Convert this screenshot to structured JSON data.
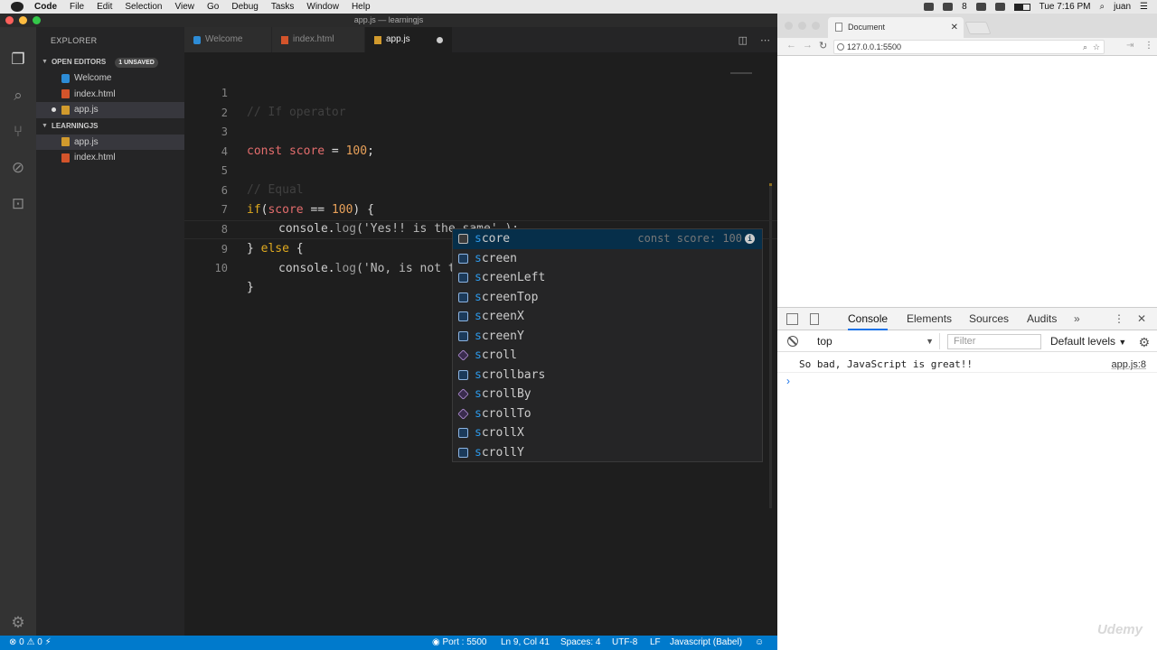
{
  "menubar": {
    "app": "Code",
    "items": [
      "File",
      "Edit",
      "Selection",
      "View",
      "Go",
      "Debug",
      "Tasks",
      "Window",
      "Help"
    ],
    "clock": "Tue 7:16 PM",
    "user": "juan",
    "tray_number": "8"
  },
  "vscode": {
    "window_title": "app.js — learningjs",
    "explorer_title": "EXPLORER",
    "open_editors": {
      "title": "OPEN EDITORS",
      "badge": "1 UNSAVED",
      "files": [
        "Welcome",
        "index.html",
        "app.js"
      ]
    },
    "folder": {
      "title": "LEARNINGJS",
      "files": [
        "app.js",
        "index.html"
      ]
    },
    "tabs": [
      "Welcome",
      "index.html",
      "app.js"
    ],
    "line_numbers": [
      "1",
      "2",
      "3",
      "4",
      "5",
      "6",
      "7",
      "8",
      "9",
      "10"
    ],
    "code": {
      "l1": "// If operator",
      "l3_kw": "const",
      "l3_var": "score",
      "l3_op": " = ",
      "l3_num": "100",
      "l3_end": ";",
      "l5": "// Equal",
      "l6_kw": "if",
      "l6_p1": "(",
      "l6_var": "score",
      "l6_op": " == ",
      "l6_num": "100",
      "l6_end": ") {",
      "l7_obj": "console",
      "l7_dot": ".",
      "l7_fn": "log",
      "l7_str": "('Yes!! is the same' );",
      "l8_br": "} ",
      "l8_kw": "else",
      "l8_end": " {",
      "l9_obj": "console",
      "l9_dot": ".",
      "l9_fn": "log",
      "l9_str": "('No, is not the same');",
      "l9_typed": "s",
      "l10": "}"
    },
    "suggestions": [
      {
        "match": "s",
        "rest": "core",
        "kind": "var",
        "detail": "const score: 100"
      },
      {
        "match": "s",
        "rest": "creen",
        "kind": "field",
        "detail": ""
      },
      {
        "match": "s",
        "rest": "creenLeft",
        "kind": "field",
        "detail": ""
      },
      {
        "match": "s",
        "rest": "creenTop",
        "kind": "field",
        "detail": ""
      },
      {
        "match": "s",
        "rest": "creenX",
        "kind": "field",
        "detail": ""
      },
      {
        "match": "s",
        "rest": "creenY",
        "kind": "field",
        "detail": ""
      },
      {
        "match": "s",
        "rest": "croll",
        "kind": "method",
        "detail": ""
      },
      {
        "match": "s",
        "rest": "crollbars",
        "kind": "field",
        "detail": ""
      },
      {
        "match": "s",
        "rest": "crollBy",
        "kind": "method",
        "detail": ""
      },
      {
        "match": "s",
        "rest": "crollTo",
        "kind": "method",
        "detail": ""
      },
      {
        "match": "s",
        "rest": "crollX",
        "kind": "field",
        "detail": ""
      },
      {
        "match": "s",
        "rest": "crollY",
        "kind": "field",
        "detail": ""
      }
    ],
    "status": {
      "errors": "0",
      "warnings": "0",
      "port": "Port : 5500",
      "cursor": "Ln 9, Col 41",
      "spaces": "Spaces: 4",
      "encoding": "UTF-8",
      "eol": "LF",
      "language": "Javascript (Babel)"
    }
  },
  "chrome": {
    "tab_title": "Document",
    "url": "127.0.0.1:5500",
    "devtools": {
      "tabs": [
        "Console",
        "Elements",
        "Sources",
        "Audits"
      ],
      "context": "top",
      "filter_placeholder": "Filter",
      "levels": "Default levels",
      "messages": [
        {
          "text": "So bad, JavaScript is great!!",
          "source": "app.js:8"
        }
      ],
      "prompt": "›"
    },
    "watermark": "Udemy"
  }
}
